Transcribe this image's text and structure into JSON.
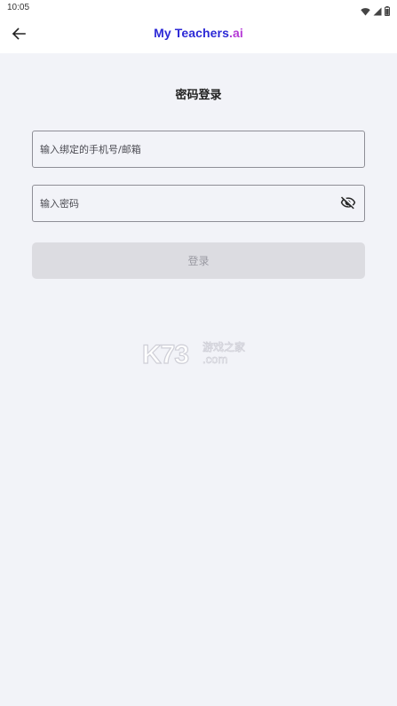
{
  "status_bar": {
    "time": "10:05",
    "icons": [
      "wifi-icon",
      "signal-icon",
      "battery-icon"
    ]
  },
  "app_bar": {
    "back_icon": "arrow-left-icon",
    "logo": {
      "part1": "My ",
      "part2": "Teachers",
      "part3": ".ai"
    }
  },
  "page": {
    "title": "密码登录"
  },
  "form": {
    "phone_placeholder": "输入绑定的手机号/邮箱",
    "phone_value": "",
    "password_placeholder": "输入密码",
    "password_value": "",
    "password_toggle_icon": "eye-off-icon",
    "login_label": "登录"
  },
  "watermark": {
    "brand": "K73",
    "cn_text": "游戏之家",
    "domain": ".com"
  },
  "colors": {
    "background": "#f2f3f8",
    "logo_primary": "#2d2ad6",
    "logo_accent": "#b53ad6",
    "button_disabled_bg": "#dcdce1",
    "button_disabled_text": "#9a9aa2"
  }
}
